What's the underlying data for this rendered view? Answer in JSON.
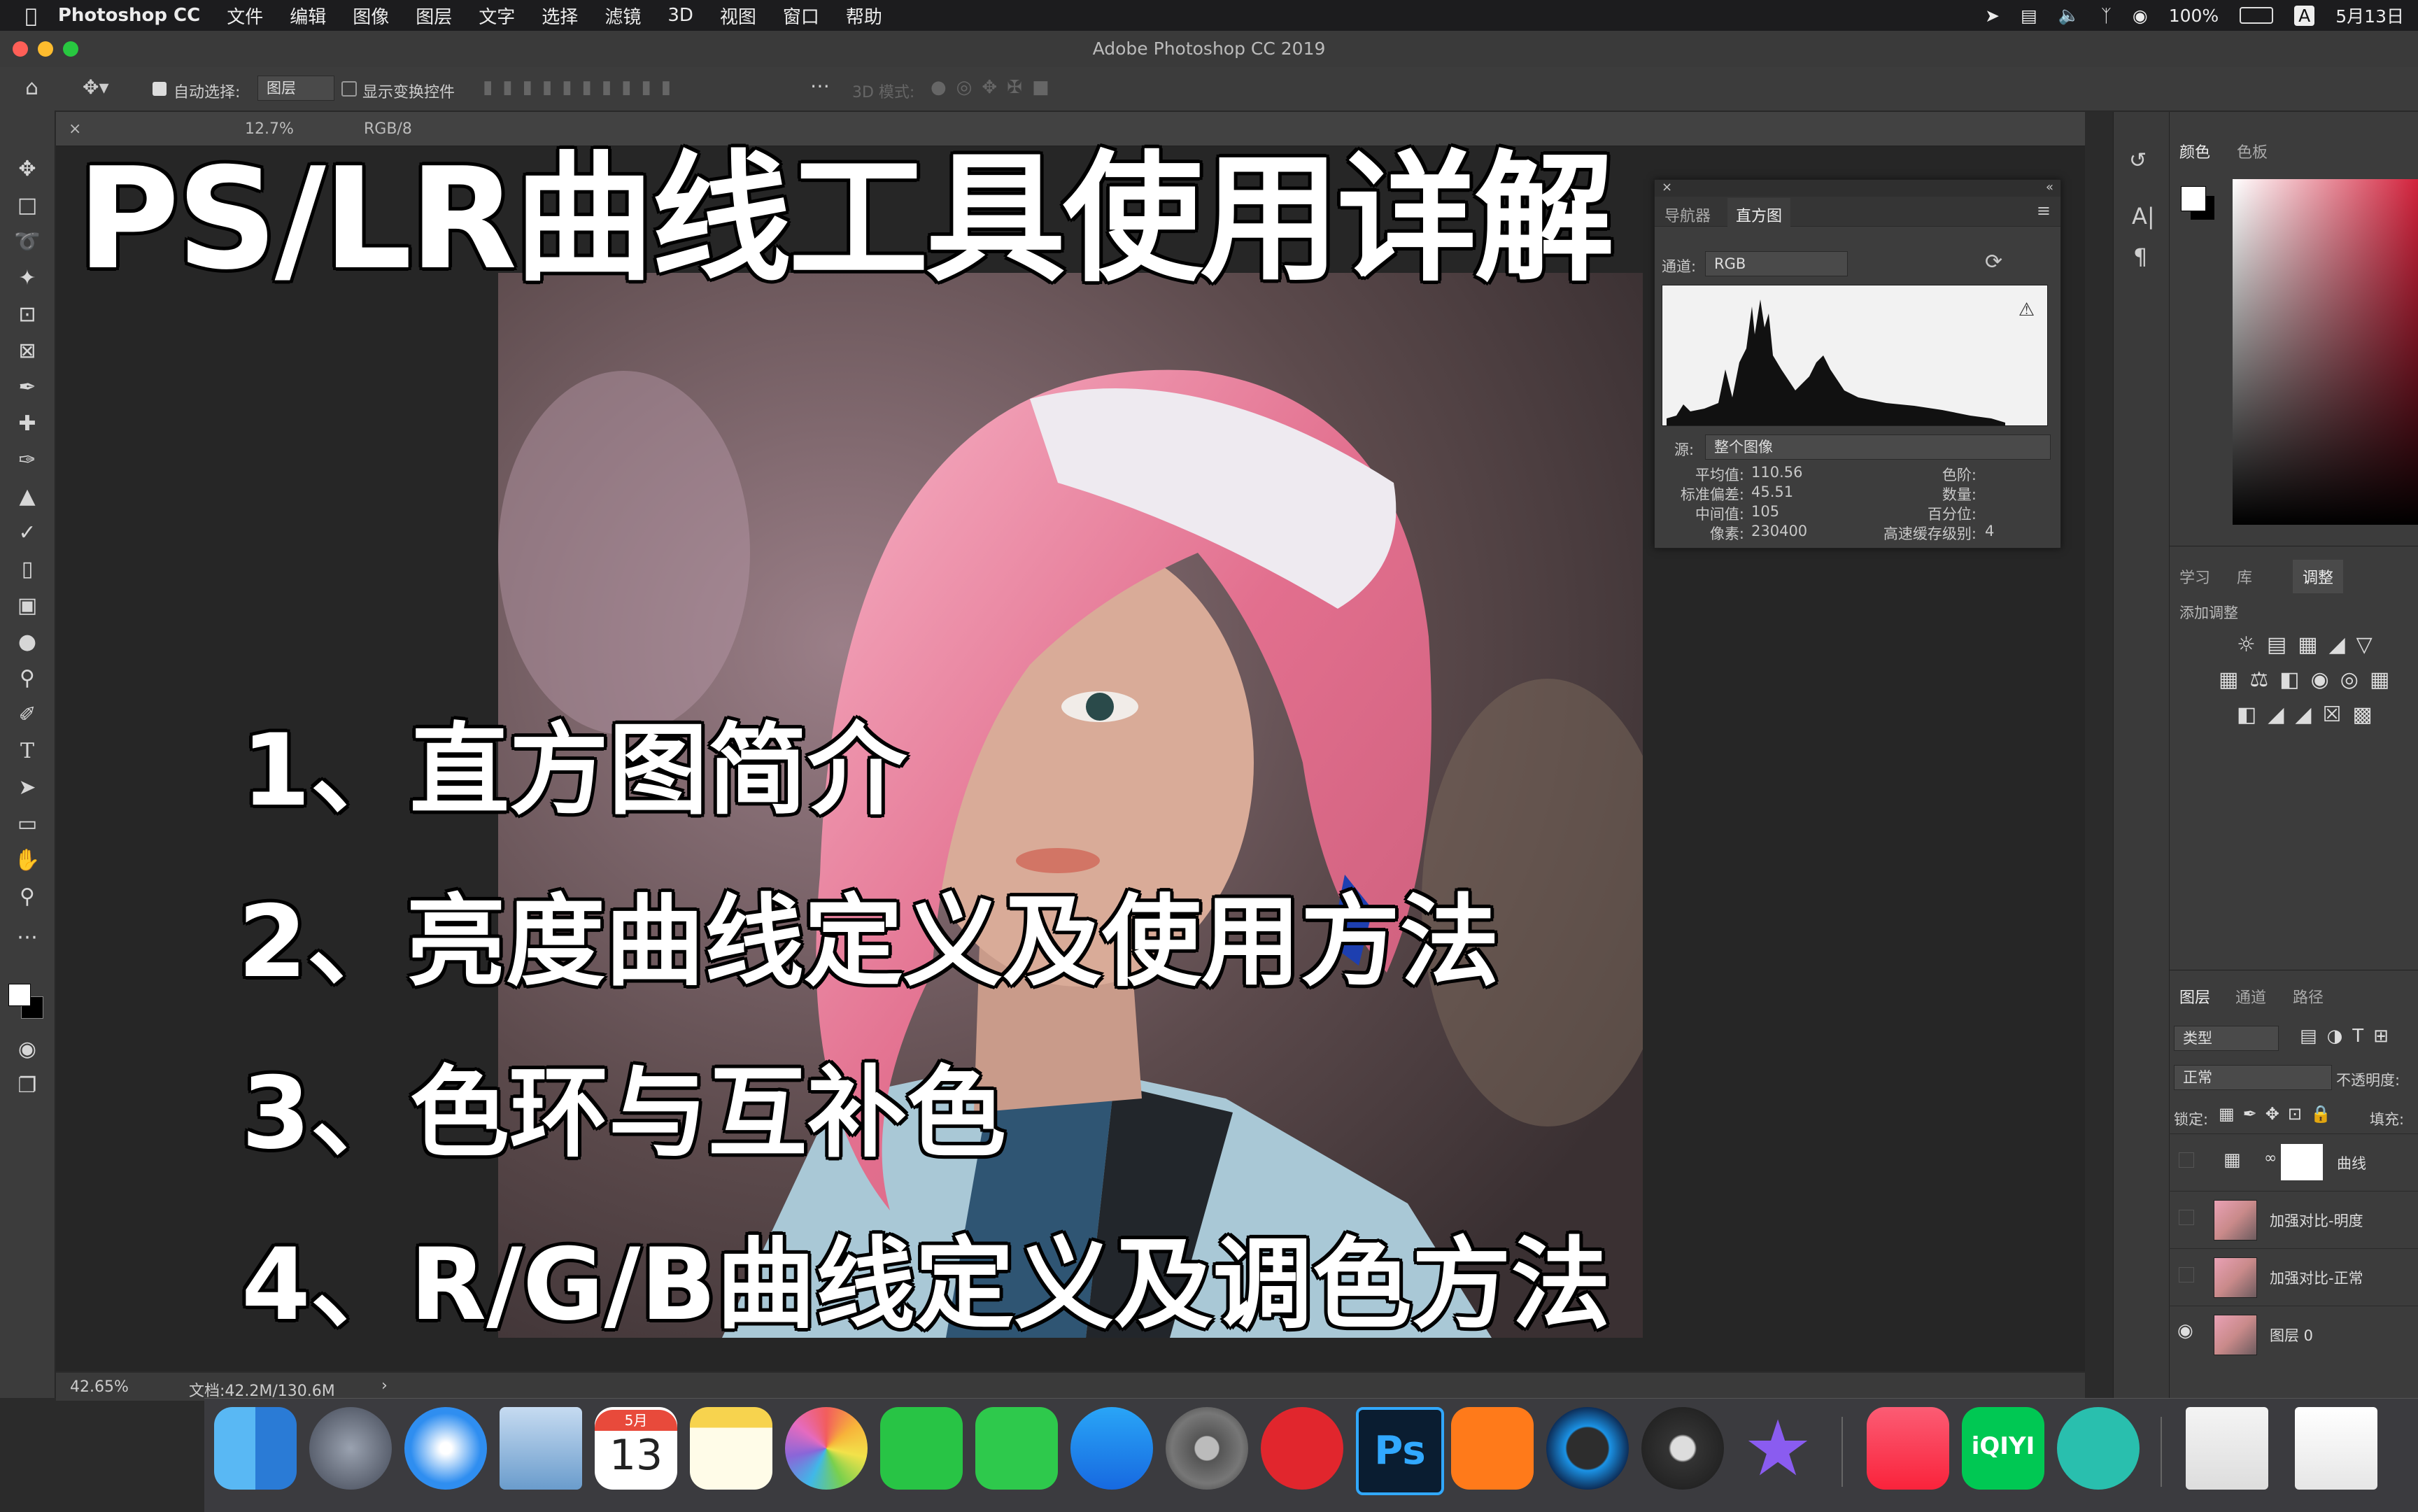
{
  "menubar": {
    "app_name": "Photoshop CC",
    "items": [
      "文件",
      "编辑",
      "图像",
      "图层",
      "文字",
      "选择",
      "滤镜",
      "3D",
      "视图",
      "窗口",
      "帮助"
    ],
    "battery": "100%",
    "date": "5月13日"
  },
  "window": {
    "title": "Adobe Photoshop CC 2019"
  },
  "options": {
    "auto_select_label": "自动选择:",
    "auto_select_value": "图层",
    "show_transform_label": "显示变换控件",
    "mode_3d_label": "3D 模式:"
  },
  "document": {
    "tab_fragment": "12.7%",
    "tab_mode": "RGB/8"
  },
  "statusbar": {
    "zoom": "42.65%",
    "doc_size": "文档:42.2M/130.6M"
  },
  "histogram": {
    "tabs": [
      "导航器",
      "直方图"
    ],
    "channel_label": "通道:",
    "channel_value": "RGB",
    "source_label": "源:",
    "source_value": "整个图像",
    "stats_left": [
      {
        "label": "平均值:",
        "value": "110.56"
      },
      {
        "label": "标准偏差:",
        "value": "45.51"
      },
      {
        "label": "中间值:",
        "value": "105"
      },
      {
        "label": "像素:",
        "value": "230400"
      }
    ],
    "stats_right": [
      {
        "label": "色阶:",
        "value": ""
      },
      {
        "label": "数量:",
        "value": ""
      },
      {
        "label": "百分位:",
        "value": ""
      },
      {
        "label": "高速缓存级别:",
        "value": "4"
      }
    ]
  },
  "right_panel": {
    "color_tabs": [
      "颜色",
      "色板"
    ],
    "adjust_tabs": [
      "学习",
      "库",
      "调整"
    ],
    "add_adjustment": "添加调整",
    "layer_tabs": [
      "图层",
      "通道",
      "路径"
    ],
    "filter_kind": "类型",
    "blend_mode": "正常",
    "opacity_label": "不透明度:",
    "lock_label": "锁定:",
    "fill_label": "填充:",
    "layers": [
      {
        "name": "曲线",
        "type": "adjustment"
      },
      {
        "name": "加强对比-明度",
        "type": "pixel"
      },
      {
        "name": "加强对比-正常",
        "type": "pixel"
      },
      {
        "name": "图层 0",
        "type": "pixel"
      }
    ]
  },
  "overlay": {
    "headline": "PS/LR曲线工具使用详解",
    "items": [
      "1、直方图简介",
      "2、亮度曲线定义及使用方法",
      "3、色环与互补色",
      "4、R/G/B曲线定义及调色方法"
    ]
  },
  "dock": {
    "calendar_month": "5月",
    "calendar_day": "13",
    "ps_label": "Ps",
    "iqiyi_label": "iQIYI",
    "apps": [
      "finder",
      "launchpad",
      "safari",
      "mail",
      "calendar",
      "notes",
      "photos",
      "wechat",
      "facetime",
      "app-store",
      "system-preferences",
      "netease-music",
      "photoshop",
      "mango-tv",
      "quicktime",
      "digital-color-meter",
      "imovie",
      "music",
      "iqiyi",
      "brain-app",
      "preview",
      "screenshot"
    ]
  }
}
